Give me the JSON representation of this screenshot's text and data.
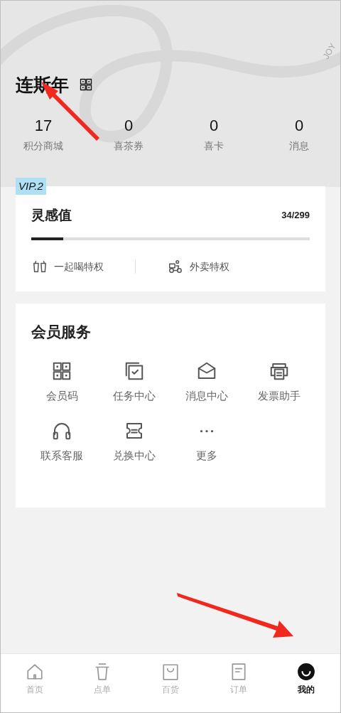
{
  "header": {
    "user_name": "连斯年",
    "brand_mark": "JOY",
    "stats": [
      {
        "value": "17",
        "label": "积分商城"
      },
      {
        "value": "0",
        "label": "喜茶券"
      },
      {
        "value": "0",
        "label": "喜卡"
      },
      {
        "value": "0",
        "label": "消息"
      }
    ]
  },
  "level_card": {
    "badge": "VIP.2",
    "title": "灵感值",
    "reading": "34/299",
    "level": 0.114,
    "privileges": [
      {
        "label": "一起喝特权"
      },
      {
        "label": "外卖特权"
      }
    ]
  },
  "services": {
    "title": "会员服务",
    "items": [
      {
        "label": "会员码"
      },
      {
        "label": "任务中心"
      },
      {
        "label": "消息中心"
      },
      {
        "label": "发票助手"
      },
      {
        "label": "联系客服"
      },
      {
        "label": "兑换中心"
      },
      {
        "label": "更多"
      }
    ]
  },
  "tab_bar": [
    {
      "label": "首页",
      "selected": false
    },
    {
      "label": "点单",
      "selected": false
    },
    {
      "label": "百货",
      "selected": false
    },
    {
      "label": "订单",
      "selected": false
    },
    {
      "label": "我的",
      "selected": true
    }
  ]
}
